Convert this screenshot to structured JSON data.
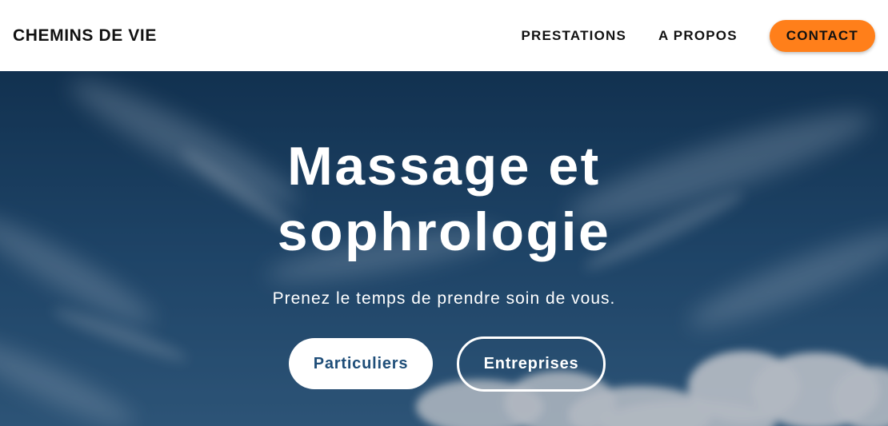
{
  "header": {
    "brand": "CHEMINS DE VIE",
    "nav": {
      "prestations": "PRESTATIONS",
      "apropos": "A PROPOS",
      "contact": "CONTACT"
    }
  },
  "hero": {
    "title_line1": "Massage et",
    "title_line2": "sophrologie",
    "subtitle": "Prenez le temps de prendre soin de vous.",
    "buttons": {
      "particuliers": "Particuliers",
      "entreprises": "Entreprises"
    }
  },
  "colors": {
    "accent": "#ff7f1a",
    "sky": "#1f4a70",
    "button_text": "#1f4e79"
  }
}
